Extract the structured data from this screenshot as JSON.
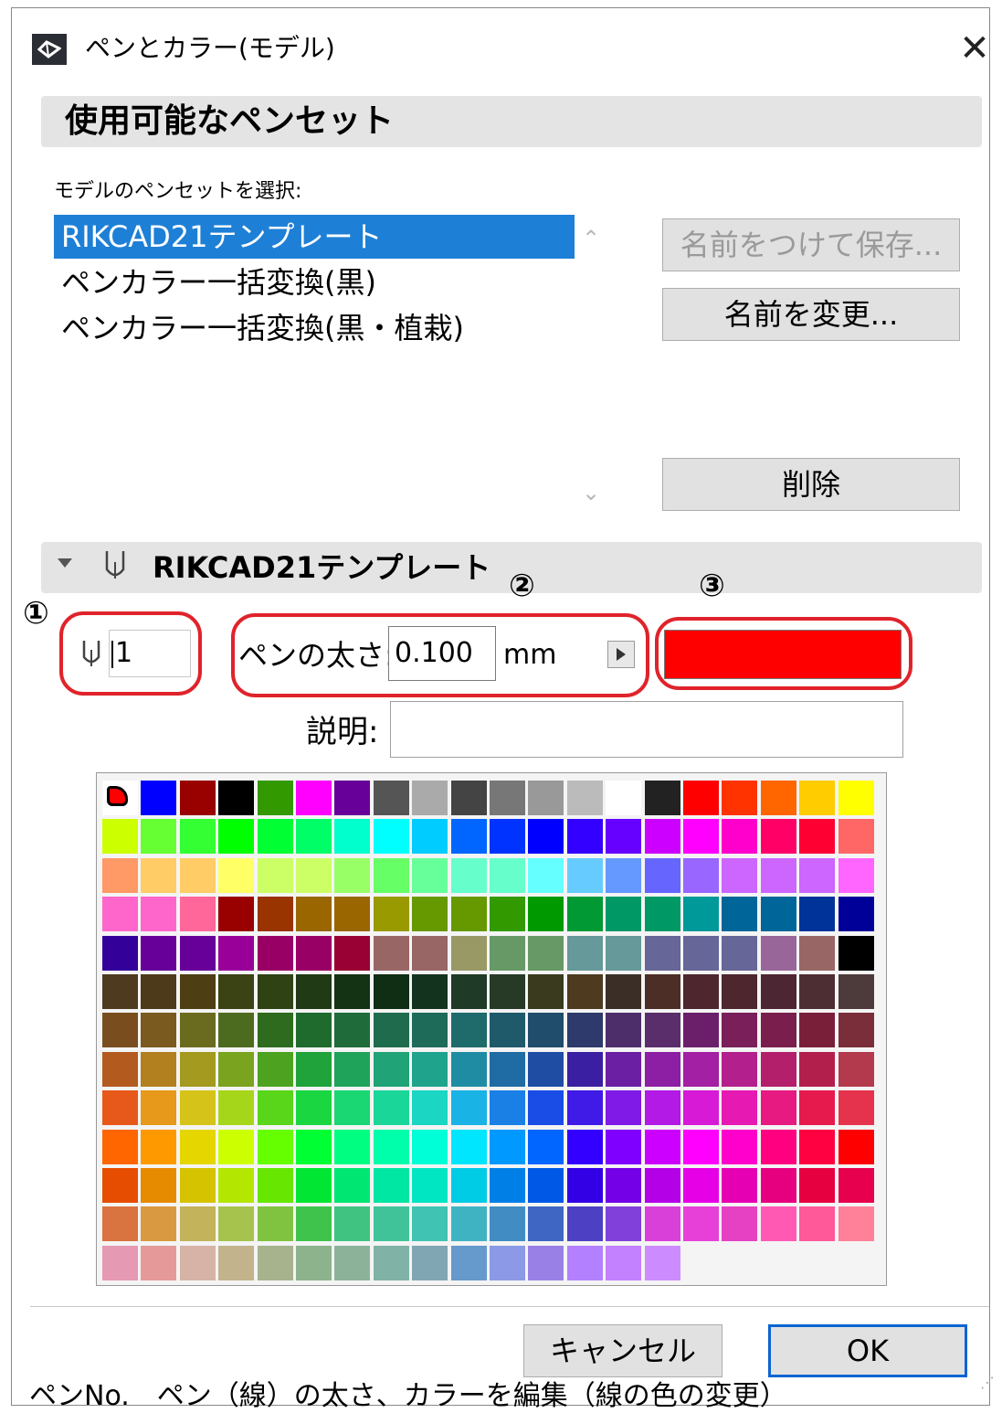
{
  "window": {
    "title": "ペンとカラー(モデル)",
    "close_label": "✕"
  },
  "available_pensets": {
    "section_title": "使用可能なペンセット",
    "select_label": "モデルのペンセットを選択:",
    "items": [
      {
        "label": "RIKCAD21テンプレート",
        "selected": true
      },
      {
        "label": "ペンカラー一括変換(黒)",
        "selected": false
      },
      {
        "label": "ペンカラー一括変換(黒・植栽)",
        "selected": false
      }
    ],
    "scroll_up": "⌃",
    "scroll_down": "⌄",
    "buttons": {
      "save_as": "名前をつけて保存...",
      "rename": "名前を変更...",
      "delete": "削除"
    }
  },
  "pen_editor": {
    "section_title": "RIKCAD21テンプレート",
    "pen_number": "1",
    "weight_label": "ペンの太さ:",
    "weight_value": "0.100",
    "unit": "mm",
    "description_label": "説明:",
    "description_value": "",
    "current_color": "#ff0000",
    "annotations": [
      "①",
      "②",
      "③"
    ]
  },
  "palette": {
    "selected_index": 0,
    "colors": [
      "#ff0000",
      "#0000ff",
      "#990000",
      "#000000",
      "#339900",
      "#ff00ff",
      "#660099",
      "#555555",
      "#aaaaaa",
      "#444444",
      "#777777",
      "#999999",
      "#bbbbbb",
      "#ffffff",
      "#222222",
      "#ff0000",
      "#ff3300",
      "#ff6600",
      "#ffcc00",
      "#ffff00",
      "#ccff00",
      "#66ff33",
      "#33ff33",
      "#00ff00",
      "#00ff33",
      "#00ff66",
      "#00ffcc",
      "#00ffff",
      "#00ccff",
      "#0066ff",
      "#0033ff",
      "#0000ff",
      "#3300ff",
      "#6600ff",
      "#cc00ff",
      "#ff00ff",
      "#ff00cc",
      "#ff0066",
      "#ff0033",
      "#ff6666",
      "#ff9966",
      "#ffcc66",
      "#ffcc66",
      "#ffff66",
      "#ccff66",
      "#ccff66",
      "#99ff66",
      "#66ff66",
      "#66ff99",
      "#66ffcc",
      "#66ffcc",
      "#66ffff",
      "#66ccff",
      "#6699ff",
      "#6666ff",
      "#9966ff",
      "#cc66ff",
      "#cc66ff",
      "#cc66ff",
      "#ff66ff",
      "#ff66cc",
      "#ff66cc",
      "#ff6699",
      "#990000",
      "#993300",
      "#996600",
      "#996600",
      "#999900",
      "#669900",
      "#669900",
      "#339900",
      "#009900",
      "#009933",
      "#009966",
      "#009966",
      "#009999",
      "#006699",
      "#006699",
      "#003399",
      "#000099",
      "#330099",
      "#660099",
      "#660099",
      "#990099",
      "#990066",
      "#990066",
      "#990033",
      "#996666",
      "#996666",
      "#999966",
      "#669966",
      "#669966",
      "#669999",
      "#669999",
      "#666699",
      "#666699",
      "#666699",
      "#996699",
      "#996666",
      "#000000",
      "#4d3a1f",
      "#4d3a1a",
      "#4d3e14",
      "#3b4214",
      "#2e4214",
      "#1f3a14",
      "#143314",
      "#0f2e14",
      "#14331f",
      "#1f3a26",
      "#263a26",
      "#3a3a1f",
      "#4d3a1f",
      "#3a2e26",
      "#4d2e26",
      "#4d262e",
      "#4d262e",
      "#4d2633",
      "#4d2e33",
      "#4d3a3a",
      "#7a4d1f",
      "#7a5a1f",
      "#6b6b1f",
      "#4d6b1f",
      "#2e6b1f",
      "#1f6b2e",
      "#1f6b3a",
      "#1f6b4d",
      "#1f6b5a",
      "#1f6b6b",
      "#1f5a6b",
      "#1f4d6b",
      "#2e3a6b",
      "#4d2e6b",
      "#5a2e6b",
      "#6b1f6b",
      "#7a1f5a",
      "#7a1f4d",
      "#7a1f3a",
      "#7a2e3a",
      "#b35a1f",
      "#b3801f",
      "#a39a1f",
      "#7aa31f",
      "#4da31f",
      "#1fa33a",
      "#1fa35a",
      "#1fa377",
      "#1fa38c",
      "#1f8ca3",
      "#1f6ba3",
      "#1f4da3",
      "#3a1fa3",
      "#6b1fa3",
      "#8c1fa3",
      "#a31fa3",
      "#b31f8c",
      "#b31f6b",
      "#b31f4d",
      "#b33a4d",
      "#e6591a",
      "#e6991a",
      "#d6c31a",
      "#a6d61a",
      "#59d61a",
      "#1ad640",
      "#1ad673",
      "#1ad699",
      "#1ad6c3",
      "#1ab3e6",
      "#1a80e6",
      "#1a4de6",
      "#401ae6",
      "#801ae6",
      "#b31ae6",
      "#d61ad6",
      "#e61ab3",
      "#e61a80",
      "#e61a4d",
      "#e6334d",
      "#ff6600",
      "#ff9900",
      "#e6d600",
      "#ccff00",
      "#66ff00",
      "#00ff33",
      "#00ff80",
      "#00ffaa",
      "#00ffd6",
      "#00e6ff",
      "#0099ff",
      "#0066ff",
      "#3300ff",
      "#8000ff",
      "#cc00ff",
      "#ff00ff",
      "#ff00cc",
      "#ff0080",
      "#ff0040",
      "#ff0000",
      "#e64d00",
      "#e68a00",
      "#d6c300",
      "#b3e600",
      "#66e600",
      "#00e633",
      "#00e673",
      "#00e6a3",
      "#00e6c3",
      "#00cce6",
      "#0080e6",
      "#0059e6",
      "#3300e6",
      "#7300e6",
      "#b300e6",
      "#e600e6",
      "#e600b3",
      "#e60080",
      "#e60040",
      "#e6004d",
      "#d97340",
      "#d99940",
      "#c3b35a",
      "#a6c34d",
      "#80c340",
      "#40c34d",
      "#40c380",
      "#40c399",
      "#40c3b3",
      "#40b3c3",
      "#408cc3",
      "#4066c3",
      "#4d40c3",
      "#8040d9",
      "#d940d9",
      "#e640d9",
      "#e640c3",
      "#ff59b3",
      "#ff5999",
      "#ff8099",
      "#e699b3",
      "#e69999",
      "#d6b3a6",
      "#c3b38c",
      "#a6b38c",
      "#8cb38c",
      "#8cb399",
      "#80b3a6",
      "#80a6b3",
      "#6699cc",
      "#8c99e6",
      "#9980e6",
      "#b380ff",
      "#c380ff",
      "#cc8cff"
    ]
  },
  "footer": {
    "cancel_label": "キャンセル",
    "ok_label": "OK"
  },
  "caption": "ペンNo.　ペン（線）の太さ、カラーを編集（線の色の変更）"
}
